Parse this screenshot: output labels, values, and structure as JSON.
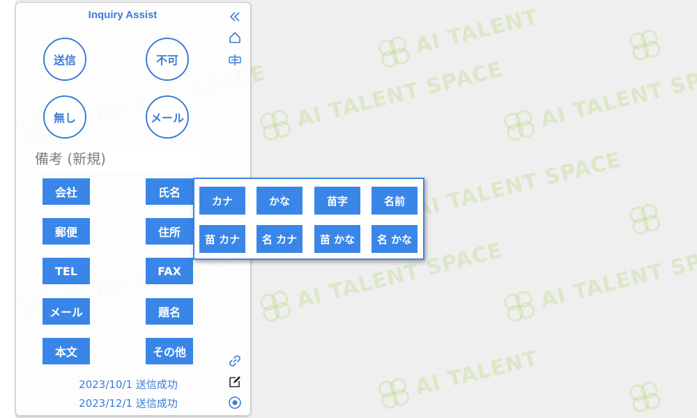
{
  "panel": {
    "title": "Inquiry Assist",
    "circle_buttons": [
      "送信",
      "不可",
      "無し",
      "メール"
    ],
    "notes_label": "備考 (新規)",
    "field_buttons": [
      "会社",
      "氏名",
      "郵便",
      "住所",
      "TEL",
      "FAX",
      "メール",
      "題名",
      "本文",
      "その他"
    ],
    "history": [
      "2023/10/1 送信成功",
      "2023/12/1 送信成功"
    ],
    "side_icons": [
      "collapse-icon",
      "home-icon",
      "translate-icon",
      "link-icon",
      "edit-icon",
      "record-icon"
    ]
  },
  "name_popup": {
    "buttons": [
      "カナ",
      "かな",
      "苗字",
      "名前",
      "苗 カナ",
      "名 カナ",
      "苗 かな",
      "名 かな"
    ]
  },
  "watermark": {
    "text": "AI TALENT SPACE",
    "color": "#b4d678"
  },
  "colors": {
    "accent": "#3a86e8",
    "title": "#3a7bd5"
  }
}
